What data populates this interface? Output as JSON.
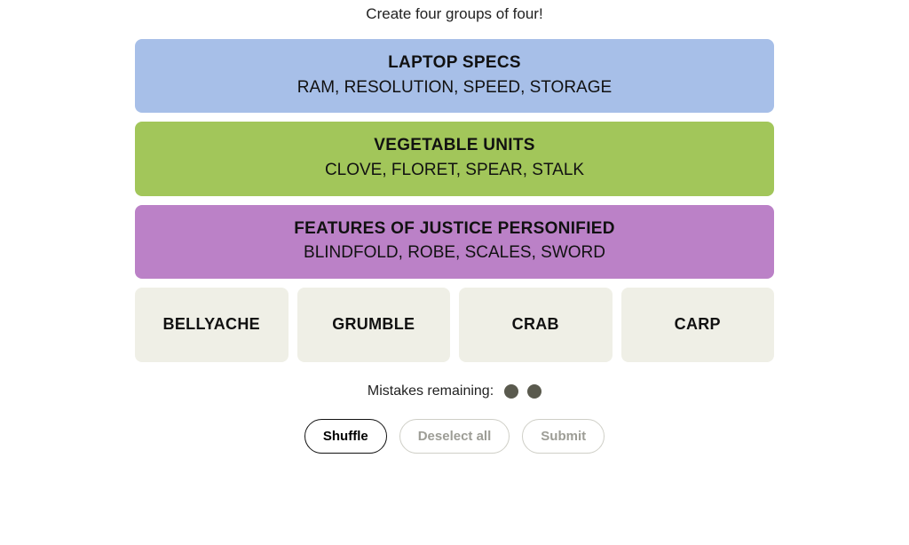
{
  "instruction": "Create four groups of four!",
  "solved": [
    {
      "color": "blue",
      "category": "LAPTOP SPECS",
      "words": "RAM, RESOLUTION, SPEED, STORAGE"
    },
    {
      "color": "green",
      "category": "VEGETABLE UNITS",
      "words": "CLOVE, FLORET, SPEAR, STALK"
    },
    {
      "color": "purple",
      "category": "FEATURES OF JUSTICE PERSONIFIED",
      "words": "BLINDFOLD, ROBE, SCALES, SWORD"
    }
  ],
  "tiles": [
    "BELLYACHE",
    "GRUMBLE",
    "CRAB",
    "CARP"
  ],
  "mistakes": {
    "label": "Mistakes remaining:",
    "remaining": 2
  },
  "controls": {
    "shuffle": "Shuffle",
    "deselect": "Deselect all",
    "submit": "Submit"
  }
}
